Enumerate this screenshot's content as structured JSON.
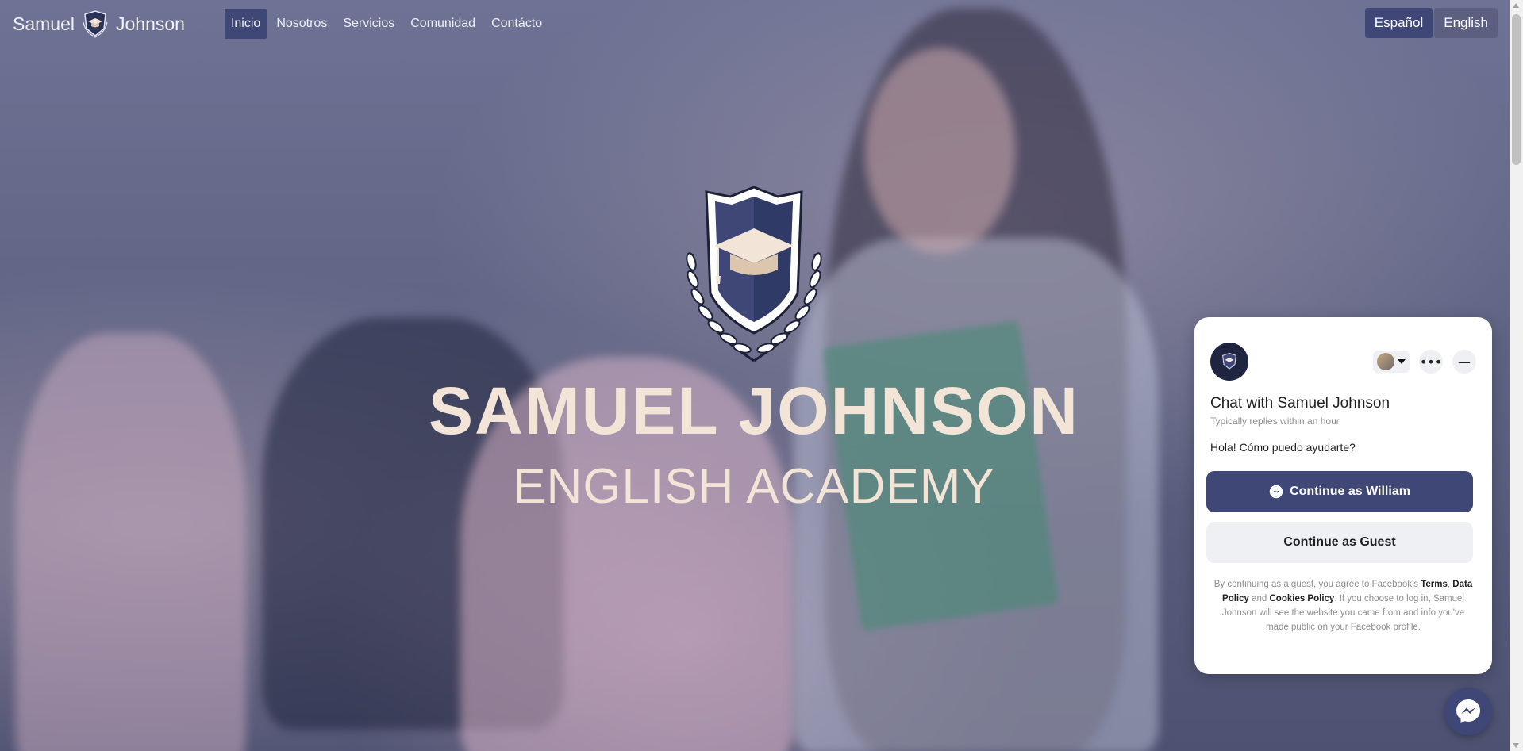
{
  "brand": {
    "left": "Samuel",
    "right": "Johnson"
  },
  "nav": {
    "items": [
      {
        "label": "Inicio",
        "active": true
      },
      {
        "label": "Nosotros",
        "active": false
      },
      {
        "label": "Servicios",
        "active": false
      },
      {
        "label": "Comunidad",
        "active": false
      },
      {
        "label": "Contácto",
        "active": false
      }
    ]
  },
  "lang": {
    "es": "Español",
    "en": "English"
  },
  "hero": {
    "title": "SAMUEL JOHNSON",
    "subtitle": "ENGLISH ACADEMY"
  },
  "chat": {
    "title": "Chat with Samuel Johnson",
    "sub": "Typically replies within an hour",
    "message": "Hola! Cómo puedo ayudarte?",
    "primary": "Continue as William",
    "secondary": "Continue as Guest",
    "legal_1": "By continuing as a guest, you agree to Facebook's ",
    "terms": "Terms",
    "comma": ",",
    "data_policy": "Data Policy",
    "and": " and ",
    "cookies": "Cookies Policy",
    "legal_2": ". If you choose to log in, Samuel Johnson will see the website you came from and info you've made public on your Facebook profile."
  },
  "colors": {
    "accent": "#3e4775",
    "crest_gold": "#f2e4d6"
  },
  "icons": {
    "brand_logo": "graduation-crest-icon",
    "crest": "graduation-crest-icon",
    "messenger": "messenger-icon"
  }
}
